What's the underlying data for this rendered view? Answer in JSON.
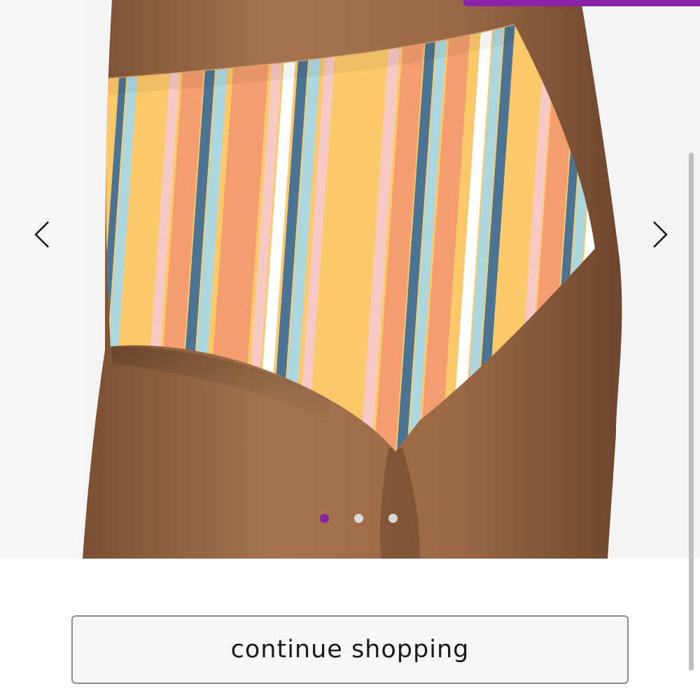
{
  "carousel": {
    "image_alt": "Striped high-waist bikini bottom",
    "prev_icon": "chevron-left-icon",
    "next_icon": "chevron-right-icon",
    "total_slides": 3,
    "active_slide": 1,
    "active_dot_color": "#8a22a8",
    "inactive_dot_color": "#d9d9d9"
  },
  "banner": {
    "color": "#8a22a8"
  },
  "actions": {
    "continue_label": "continue shopping"
  },
  "colors": {
    "stripe_yellow": "#fcc96a",
    "stripe_orange": "#f49d6e",
    "stripe_navy": "#4b7393",
    "stripe_light_blue": "#acd7df",
    "stripe_pink": "#f6c9c4",
    "skin": "#9a6a45"
  }
}
